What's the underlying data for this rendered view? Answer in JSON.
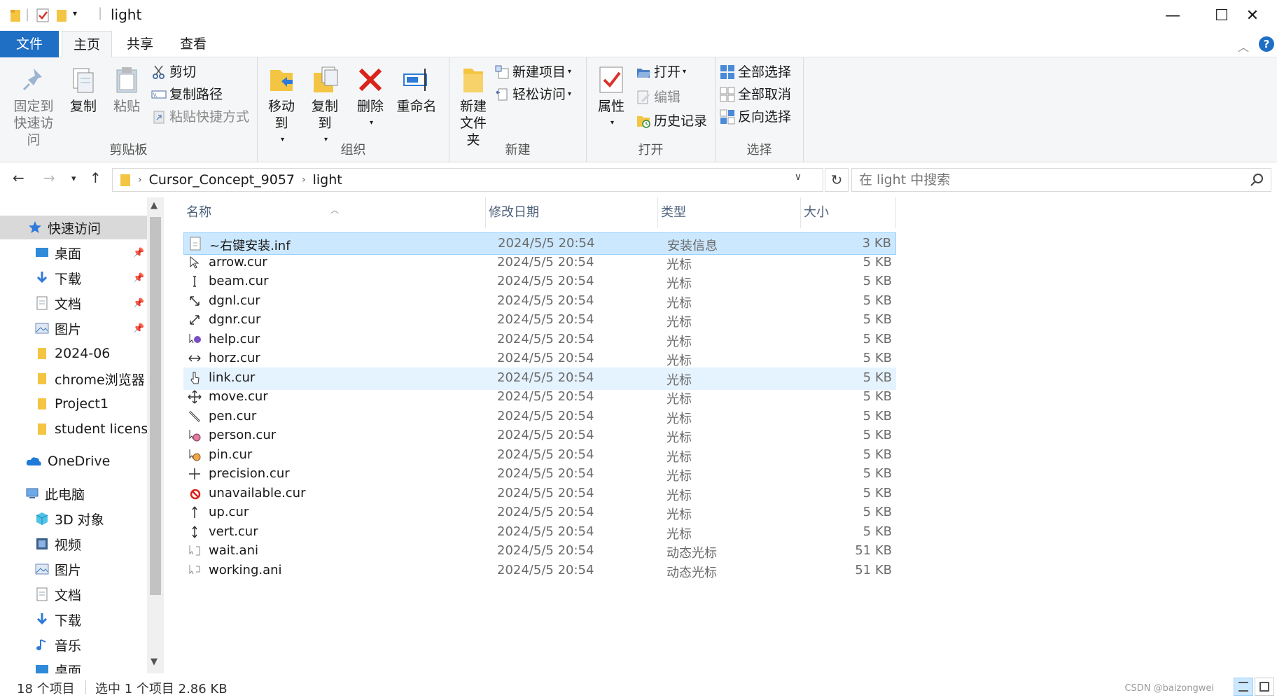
{
  "window": {
    "title": "light",
    "minimize_glyph": "—",
    "maximize_glyph": "☐",
    "close_glyph": "✕"
  },
  "ribbon_tabs": {
    "file": "文件",
    "home": "主页",
    "share": "共享",
    "view": "查看"
  },
  "help_glyph": "?",
  "ribbon": {
    "clipboard": {
      "label": "剪贴板",
      "pin_quick_access": "固定到快速访问",
      "copy": "复制",
      "paste": "粘贴",
      "cut": "剪切",
      "copy_path": "复制路径",
      "paste_shortcut": "粘贴快捷方式"
    },
    "organize": {
      "label": "组织",
      "move_to": "移动到",
      "copy_to": "复制到",
      "delete": "删除",
      "rename": "重命名"
    },
    "new": {
      "label": "新建",
      "new_folder": "新建文件夹",
      "new_item": "新建项目",
      "easy_access": "轻松访问"
    },
    "open": {
      "label": "打开",
      "properties": "属性",
      "open": "打开",
      "edit": "编辑",
      "history": "历史记录"
    },
    "select": {
      "label": "选择",
      "select_all": "全部选择",
      "select_none": "全部取消",
      "invert_selection": "反向选择"
    }
  },
  "address": {
    "path": [
      "Cursor_Concept_9057",
      "light"
    ],
    "search_placeholder": "在 light 中搜索"
  },
  "nav_pane": {
    "quick_access": "快速访问",
    "quick_items": [
      {
        "label": "桌面",
        "pinned": true
      },
      {
        "label": "下载",
        "pinned": true
      },
      {
        "label": "文档",
        "pinned": true
      },
      {
        "label": "图片",
        "pinned": true
      },
      {
        "label": "2024-06",
        "pinned": false
      },
      {
        "label": "chrome浏览器",
        "pinned": false
      },
      {
        "label": "Project1",
        "pinned": false
      },
      {
        "label": "student license",
        "pinned": false
      }
    ],
    "onedrive": "OneDrive",
    "this_pc": "此电脑",
    "pc_items": [
      "3D 对象",
      "视频",
      "图片",
      "文档",
      "下载",
      "音乐",
      "桌面"
    ]
  },
  "file_list": {
    "columns": {
      "name": "名称",
      "date": "修改日期",
      "type": "类型",
      "size": "大小"
    },
    "files": [
      {
        "name": "~右键安装.inf",
        "date": "2024/5/5 20:54",
        "type": "安装信息",
        "size": "3 KB",
        "icon": "inf-file-icon"
      },
      {
        "name": "arrow.cur",
        "date": "2024/5/5 20:54",
        "type": "光标",
        "size": "5 KB",
        "icon": "arrow-cursor-icon"
      },
      {
        "name": "beam.cur",
        "date": "2024/5/5 20:54",
        "type": "光标",
        "size": "5 KB",
        "icon": "beam-cursor-icon"
      },
      {
        "name": "dgnl.cur",
        "date": "2024/5/5 20:54",
        "type": "光标",
        "size": "5 KB",
        "icon": "diagonal-left-cursor-icon"
      },
      {
        "name": "dgnr.cur",
        "date": "2024/5/5 20:54",
        "type": "光标",
        "size": "5 KB",
        "icon": "diagonal-right-cursor-icon"
      },
      {
        "name": "help.cur",
        "date": "2024/5/5 20:54",
        "type": "光标",
        "size": "5 KB",
        "icon": "help-cursor-icon"
      },
      {
        "name": "horz.cur",
        "date": "2024/5/5 20:54",
        "type": "光标",
        "size": "5 KB",
        "icon": "horizontal-cursor-icon"
      },
      {
        "name": "link.cur",
        "date": "2024/5/5 20:54",
        "type": "光标",
        "size": "5 KB",
        "icon": "link-cursor-icon"
      },
      {
        "name": "move.cur",
        "date": "2024/5/5 20:54",
        "type": "光标",
        "size": "5 KB",
        "icon": "move-cursor-icon"
      },
      {
        "name": "pen.cur",
        "date": "2024/5/5 20:54",
        "type": "光标",
        "size": "5 KB",
        "icon": "pen-cursor-icon"
      },
      {
        "name": "person.cur",
        "date": "2024/5/5 20:54",
        "type": "光标",
        "size": "5 KB",
        "icon": "person-cursor-icon"
      },
      {
        "name": "pin.cur",
        "date": "2024/5/5 20:54",
        "type": "光标",
        "size": "5 KB",
        "icon": "pin-cursor-icon"
      },
      {
        "name": "precision.cur",
        "date": "2024/5/5 20:54",
        "type": "光标",
        "size": "5 KB",
        "icon": "precision-cursor-icon"
      },
      {
        "name": "unavailable.cur",
        "date": "2024/5/5 20:54",
        "type": "光标",
        "size": "5 KB",
        "icon": "unavailable-cursor-icon"
      },
      {
        "name": "up.cur",
        "date": "2024/5/5 20:54",
        "type": "光标",
        "size": "5 KB",
        "icon": "up-cursor-icon"
      },
      {
        "name": "vert.cur",
        "date": "2024/5/5 20:54",
        "type": "光标",
        "size": "5 KB",
        "icon": "vertical-cursor-icon"
      },
      {
        "name": "wait.ani",
        "date": "2024/5/5 20:54",
        "type": "动态光标",
        "size": "51 KB",
        "icon": "wait-animated-cursor-icon"
      },
      {
        "name": "working.ani",
        "date": "2024/5/5 20:54",
        "type": "动态光标",
        "size": "51 KB",
        "icon": "working-animated-cursor-icon"
      }
    ],
    "selected_index": 0,
    "hover_index": 7
  },
  "status": {
    "item_count": "18 个项目",
    "selection": "选中 1 个项目  2.86 KB",
    "watermark": "CSDN @baizongwei"
  },
  "colors": {
    "accent": "#1f6fc5",
    "selection_bg": "#cce8ff",
    "folder_yellow": "#f4c542"
  }
}
